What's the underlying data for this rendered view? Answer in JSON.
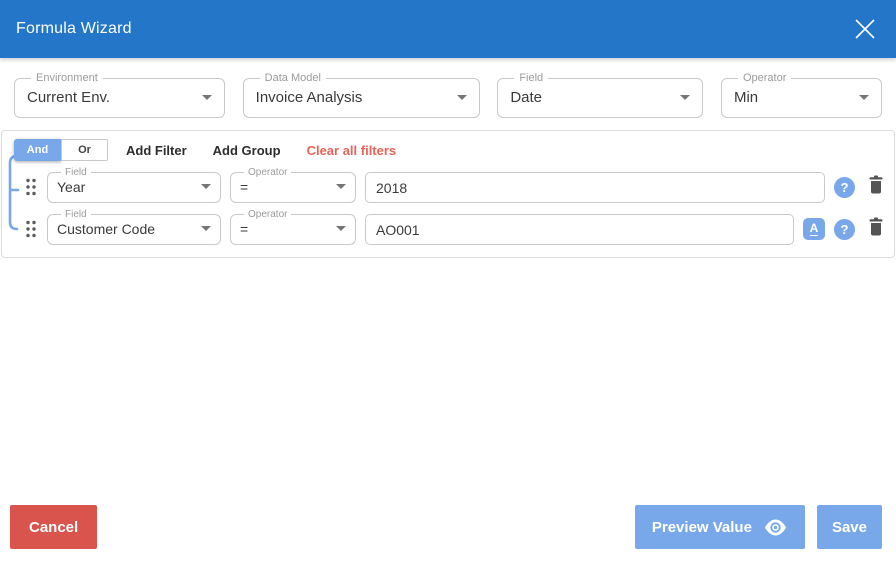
{
  "header": {
    "title": "Formula Wizard"
  },
  "selectors": [
    {
      "label": "Environment",
      "value": "Current Env."
    },
    {
      "label": "Data Model",
      "value": "Invoice Analysis"
    },
    {
      "label": "Field",
      "value": "Date"
    },
    {
      "label": "Operator",
      "value": "Min"
    }
  ],
  "filter_builder": {
    "toggle": {
      "and": "And",
      "or": "Or",
      "selected": "And"
    },
    "actions": {
      "add_filter": "Add Filter",
      "add_group": "Add Group",
      "clear_all": "Clear all filters"
    },
    "rows": [
      {
        "field_label": "Field",
        "field_value": "Year",
        "operator_label": "Operator",
        "operator_value": "=",
        "value": "2018"
      },
      {
        "field_label": "Field",
        "field_value": "Customer Code",
        "operator_label": "Operator",
        "operator_value": "=",
        "value": "AO001"
      }
    ]
  },
  "footer": {
    "cancel": "Cancel",
    "preview": "Preview Value",
    "save": "Save"
  },
  "icons": {
    "close": "close-x",
    "dropdown": "caret-down",
    "drag": "drag-dots",
    "text_case": "letter-a-underline",
    "help": "question-mark-circle",
    "delete": "trash-can",
    "preview": "eye"
  },
  "colors": {
    "header_blue": "#2376c8",
    "accent_blue": "#78a8e9",
    "cancel_red": "#d9544d",
    "clear_red": "#e8645a"
  }
}
